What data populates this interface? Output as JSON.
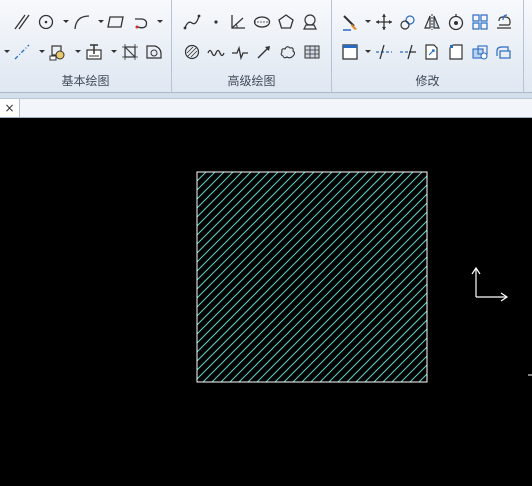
{
  "ribbon": {
    "groups": [
      {
        "label": "基本绘图"
      },
      {
        "label": "高级绘图"
      },
      {
        "label": "修改"
      }
    ]
  },
  "tabs": {
    "close_label": "×"
  },
  "colors": {
    "hatch": "#5fd0c8",
    "boundary": "#ffffff",
    "canvas": "#000000",
    "ribbon_bg": "#e8eef6"
  },
  "icons": [
    "parallel-line-icon",
    "circle-icon",
    "arc-icon",
    "rectangle-icon",
    "polyline-icon",
    "centerline-icon",
    "block-icon",
    "text-icon",
    "crop-icon",
    "region-icon",
    "spline-icon",
    "point-icon",
    "angle-line-icon",
    "ellipse-icon",
    "polygon-icon",
    "symbol-icon",
    "hatch-circle-icon",
    "wave-line-icon",
    "break-line-icon",
    "arrow-icon",
    "cloud-icon",
    "table-icon",
    "brush-icon",
    "move-icon",
    "rotate-icon",
    "mirror-icon",
    "scale-icon",
    "array-icon",
    "offset-icon",
    "select-box-icon",
    "trim-icon",
    "extend-icon",
    "copy-icon",
    "chamfer-icon",
    "explode-icon",
    "layer-icon"
  ]
}
